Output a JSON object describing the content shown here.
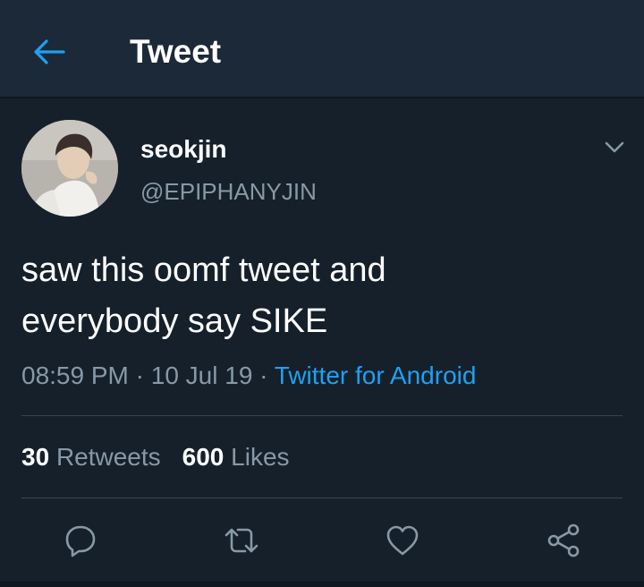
{
  "header": {
    "title": "Tweet",
    "back_icon": "arrow-left-icon"
  },
  "tweet": {
    "author": {
      "name": "seokjin",
      "handle": "@EPIPHANYJIN"
    },
    "text_lines": [
      "saw this oomf tweet and",
      "everybody say SIKE"
    ],
    "time": "08:59 PM",
    "date": "10 Jul 19",
    "separator": "·",
    "source": "Twitter for Android",
    "retweets": {
      "count": "30",
      "label": "Retweets"
    },
    "likes": {
      "count": "600",
      "label": "Likes"
    }
  },
  "actions": [
    "reply-icon",
    "retweet-icon",
    "like-icon",
    "share-icon"
  ],
  "colors": {
    "background": "#15202b",
    "header_bg": "#1c2938",
    "accent": "#1da1f2",
    "secondary_text": "#8899a6",
    "divider": "#38444d"
  }
}
